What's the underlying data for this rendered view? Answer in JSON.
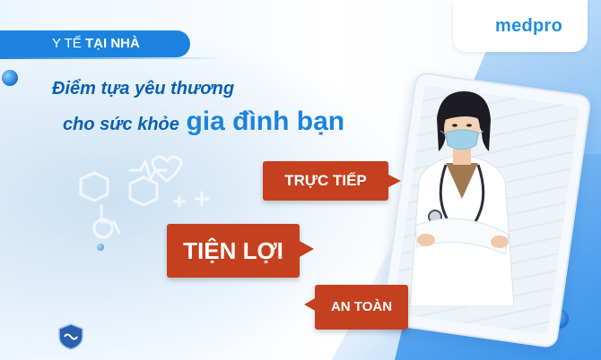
{
  "brand": {
    "name": "medpro",
    "color": "#1d8fe0"
  },
  "tag": {
    "prefix": "Y TẾ",
    "bold": "TẠI NHÀ"
  },
  "headline": {
    "line1": "Điểm tựa yêu thương",
    "line2_prefix": "cho sức khỏe",
    "line2_emphasis": "gia đình bạn"
  },
  "bubbles": {
    "b1": "TRỰC TIẾP",
    "b2": "TIỆN LỢI",
    "b3": "AN TOÀN"
  },
  "colors": {
    "bubble": "#c5401f",
    "primary": "#1b83df",
    "headline": "#0b5fb4"
  },
  "icons": [
    "heart-icon",
    "wheelchair-icon",
    "medical-cross-icon",
    "heartbeat-icon",
    "shield-logo-icon",
    "doctor-illustration"
  ]
}
